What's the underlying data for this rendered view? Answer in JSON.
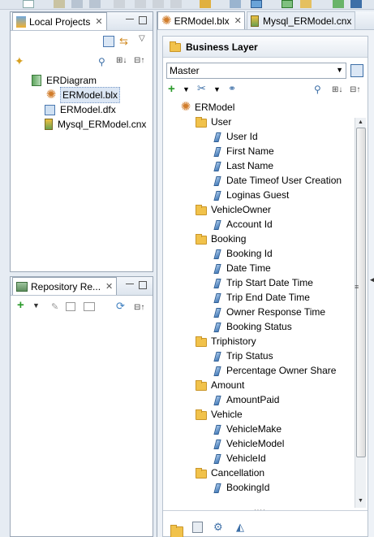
{
  "left_panel": {
    "tab_title": "Local Projects",
    "tree": [
      {
        "label": "ERDiagram",
        "icon": "project-icon"
      },
      {
        "label": "ERModel.blx",
        "icon": "business-layer-icon",
        "selected": true
      },
      {
        "label": "ERModel.dfx",
        "icon": "data-foundation-icon"
      },
      {
        "label": "Mysql_ERModel.cnx",
        "icon": "connection-icon"
      }
    ]
  },
  "repo_panel": {
    "tab_title": "Repository Re..."
  },
  "editor": {
    "tabs": [
      {
        "label": "ERModel.blx",
        "active": true
      },
      {
        "label": "Mysql_ERModel.cnx",
        "active": false
      }
    ],
    "section_title": "Business Layer",
    "combo_value": "Master",
    "root": "ERModel",
    "folders": [
      {
        "name": "User",
        "items": [
          "User Id",
          "First Name",
          "Last Name",
          "Date Timeof User Creation",
          "Loginas Guest"
        ]
      },
      {
        "name": "VehicleOwner",
        "items": [
          "Account Id"
        ]
      },
      {
        "name": "Booking",
        "items": [
          "Booking Id",
          "Date Time",
          "Trip Start Date Time",
          "Trip End Date Time",
          "Owner Response Time",
          "Booking Status"
        ]
      },
      {
        "name": "Triphistory",
        "items": [
          "Trip Status",
          "Percentage Owner Share"
        ]
      },
      {
        "name": "Amount",
        "items": [
          "AmountPaid"
        ]
      },
      {
        "name": "Vehicle",
        "items": [
          "VehicleMake",
          "VehicleModel",
          "VehicleId"
        ]
      },
      {
        "name": "Cancellation",
        "items": [
          "BookingId"
        ]
      }
    ]
  },
  "colors": {
    "accent": "#2a9a2a",
    "folder": "#f1c24b",
    "attribute": "#3f78b8"
  }
}
